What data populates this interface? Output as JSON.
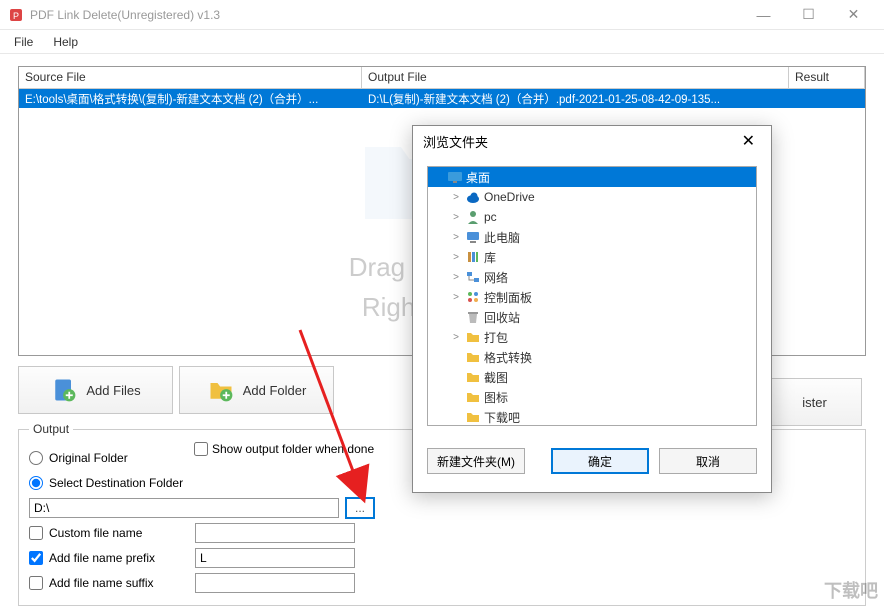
{
  "window": {
    "title": "PDF Link Delete(Unregistered) v1.3"
  },
  "menu": {
    "file": "File",
    "help": "Help"
  },
  "table": {
    "headers": {
      "source": "Source File",
      "output": "Output File",
      "result": "Result"
    },
    "row": {
      "source": "E:\\tools\\桌面\\格式转换\\(复制)-新建文本文档 (2)（合并）...",
      "output": "D:\\L(复制)-新建文本文档 (2)（合并）.pdf-2021-01-25-08-42-09-135...",
      "result": ""
    },
    "hint1": "Drag and drop y",
    "hint2": "Right-click  Re"
  },
  "buttons": {
    "addFiles": "Add Files",
    "addFolder": "Add Folder",
    "register": "ister"
  },
  "output": {
    "legend": "Output",
    "original": "Original Folder",
    "select": "Select Destination Folder",
    "path": "D:\\",
    "browse": "...",
    "showDone": "Show output folder when done",
    "customName": "Custom file name",
    "prefix": "Add file name prefix",
    "prefixValue": "L",
    "suffix": "Add file name suffix"
  },
  "dialog": {
    "title": "浏览文件夹",
    "items": [
      {
        "label": "桌面",
        "level": 0,
        "selected": true,
        "icon": "desktop",
        "expand": ""
      },
      {
        "label": "OneDrive",
        "level": 1,
        "icon": "cloud",
        "expand": ">"
      },
      {
        "label": "pc",
        "level": 1,
        "icon": "user",
        "expand": ">"
      },
      {
        "label": "此电脑",
        "level": 1,
        "icon": "pc",
        "expand": ">"
      },
      {
        "label": "库",
        "level": 1,
        "icon": "lib",
        "expand": ">"
      },
      {
        "label": "网络",
        "level": 1,
        "icon": "net",
        "expand": ">"
      },
      {
        "label": "控制面板",
        "level": 1,
        "icon": "panel",
        "expand": ">"
      },
      {
        "label": "回收站",
        "level": 1,
        "icon": "bin",
        "expand": ""
      },
      {
        "label": "打包",
        "level": 1,
        "icon": "folder",
        "expand": ">"
      },
      {
        "label": "格式转换",
        "level": 1,
        "icon": "folder",
        "expand": ""
      },
      {
        "label": "截图",
        "level": 1,
        "icon": "folder",
        "expand": ""
      },
      {
        "label": "图标",
        "level": 1,
        "icon": "folder",
        "expand": ""
      },
      {
        "label": "下载吧",
        "level": 1,
        "icon": "folder",
        "expand": ""
      }
    ],
    "newFolder": "新建文件夹(M)",
    "ok": "确定",
    "cancel": "取消"
  },
  "watermark": "下载吧"
}
